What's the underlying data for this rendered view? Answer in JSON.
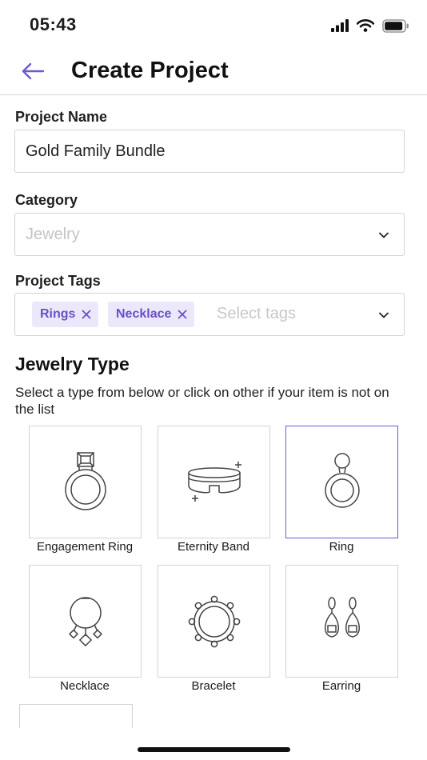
{
  "status_bar": {
    "time": "05:43",
    "icons": [
      "signal-icon",
      "wifi-icon",
      "battery-icon"
    ]
  },
  "header": {
    "back_icon": "arrow-left-icon",
    "title": "Create Project"
  },
  "form": {
    "project_name": {
      "label": "Project Name",
      "value": "Gold Family Bundle"
    },
    "category": {
      "label": "Category",
      "value": "Jewelry"
    },
    "project_tags": {
      "label": "Project Tags",
      "tags": [
        "Rings",
        "Necklace"
      ],
      "placeholder": "Select tags"
    }
  },
  "jewelry_type": {
    "title": "Jewelry Type",
    "description": "Select a type from below or click on other if your item is not on the list",
    "items": [
      {
        "label": "Engagement Ring",
        "icon": "engagement-ring-icon",
        "selected": false
      },
      {
        "label": "Eternity Band",
        "icon": "eternity-band-icon",
        "selected": false
      },
      {
        "label": "Ring",
        "icon": "ring-icon",
        "selected": true
      },
      {
        "label": "Necklace",
        "icon": "necklace-icon",
        "selected": false
      },
      {
        "label": "Bracelet",
        "icon": "bracelet-icon",
        "selected": false
      },
      {
        "label": "Earring",
        "icon": "earring-icon",
        "selected": false
      }
    ]
  },
  "colors": {
    "accent": "#6a5ad0",
    "tag_background": "#ece8fb",
    "tag_text": "#6a4fc8",
    "border": "#d3d3d3",
    "placeholder": "#c4c4c4"
  }
}
